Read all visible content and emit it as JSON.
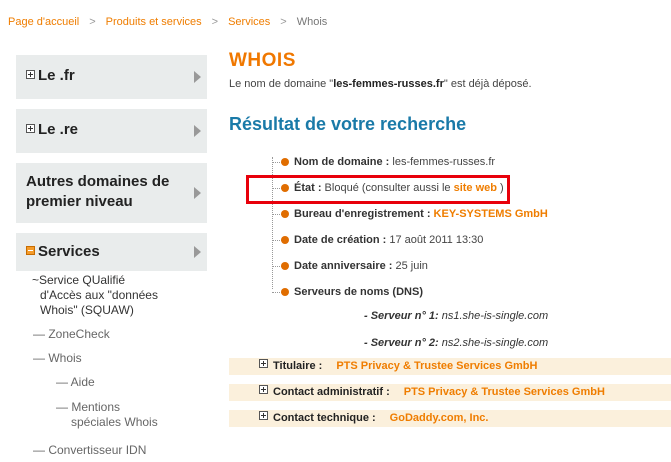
{
  "breadcrumb": {
    "items": [
      "Page d'accueil",
      "Produits et services",
      "Services"
    ],
    "separator": ">",
    "current": "Whois"
  },
  "sidebar": {
    "blocks": [
      {
        "label": "Le .fr"
      },
      {
        "label": "Le .re"
      },
      {
        "label": "Autres domaines de premier niveau"
      },
      {
        "label": "Services"
      }
    ],
    "services_items": {
      "squaw_line1": "~Service QUalifié",
      "squaw_line2": "d'Accès aux \"données Whois\" (SQUAW)",
      "zonecheck": "— ZoneCheck",
      "whois": "— Whois",
      "aide": "— Aide",
      "mentions_line1": "— Mentions",
      "mentions_line2": "spéciales Whois",
      "idn": "— Convertisseur IDN"
    }
  },
  "main": {
    "title": "WHOIS",
    "intro_prefix": "Le nom de domaine \"",
    "intro_domain": "les-femmes-russes.fr",
    "intro_suffix": "\" est déjà déposé.",
    "result_title": "Résultat de votre recherche",
    "fields": {
      "domain_label": "Nom de domaine :",
      "domain_value": " les-femmes-russes.fr",
      "etat_label": "État :",
      "etat_value": " Bloqué (consulter aussi le ",
      "etat_link": "site web",
      "etat_end": " )",
      "bureau_label": "Bureau d'enregistrement :",
      "bureau_value": "KEY-SYSTEMS GmbH",
      "creation_label": "Date de création :",
      "creation_value": " 17 août 2011 13:30",
      "anniversaire_label": "Date anniversaire :",
      "anniversaire_value": " 25 juin",
      "serveurs_label": "Serveurs de noms (DNS)"
    },
    "nameservers": [
      {
        "label": "- Serveur n° 1:",
        "value": " ns1.she-is-single.com"
      },
      {
        "label": "- Serveur n° 2:",
        "value": " ns2.she-is-single.com"
      }
    ]
  },
  "sections": [
    {
      "label": "Titulaire :",
      "value": "PTS Privacy & Trustee Services GmbH"
    },
    {
      "label": "Contact administratif :",
      "value": "PTS Privacy & Trustee Services GmbH"
    },
    {
      "label": "Contact technique :",
      "value": "GoDaddy.com, Inc."
    }
  ],
  "colors": {
    "accent_orange": "#ef7d00",
    "title_blue": "#1a7aa8",
    "highlight_red": "#e8000b",
    "sidebar_bg": "#e9ecec",
    "section_bg": "#fbf0dc"
  }
}
